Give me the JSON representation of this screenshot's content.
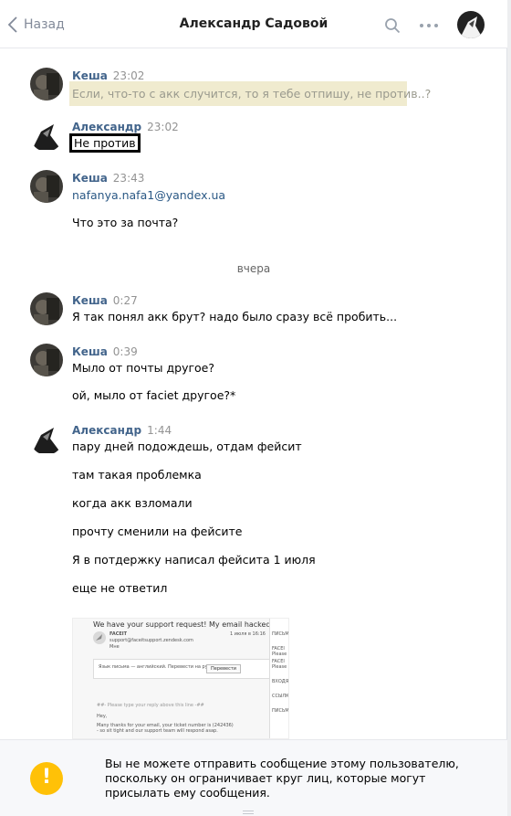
{
  "header": {
    "back_label": "Назад",
    "title": "Александр Садовой"
  },
  "messages": [
    {
      "author": "Кеша",
      "time": "23:02",
      "lines": [
        "Если, что-то с акк случится, то я тебе отпишу, не против..?"
      ]
    },
    {
      "author": "Александр",
      "time": "23:02",
      "lines": [
        "Не против"
      ]
    },
    {
      "author": "Кеша",
      "time": "23:43",
      "lines": [
        "nafanya.nafa1@yandex.ua",
        "Что это за почта?"
      ]
    },
    {
      "author": "Кеша",
      "time": "0:27",
      "lines": [
        "Я так понял акк брут? надо было сразу всё пробить..."
      ]
    },
    {
      "author": "Кеша",
      "time": "0:39",
      "lines": [
        "Мыло от почты другое?",
        "ой, мыло от faciet другое?*"
      ]
    },
    {
      "author": "Александр",
      "time": "1:44",
      "lines": [
        "пару дней подождешь, отдам фейсит",
        "там такая проблемка",
        "когда акк взломали",
        "прочту сменили на фейсите",
        "Я в потдержку написал фейсита 1 июля",
        "еще не ответил"
      ]
    }
  ],
  "date_separator": "вчера",
  "attachment": {
    "header": "We have your support request! My email hacked",
    "sender": "FACEIT",
    "sender_email": "support@faceitsupport.zendesk.com",
    "to": "Мне",
    "date": "1 июля в 16:16",
    "translate_text": "Язык письма — английский. Перевести на русский?",
    "translate_button": "Перевести",
    "reply_line": "##- Please type your reply above this line -##",
    "greeting": "Hey,",
    "body": "Many thanks for your email, your ticket number is (242436) - so sit tight and our support team will respond asap.",
    "side_items": [
      "ПИСЬМ",
      "FACEI",
      "Please",
      "FACEI",
      "Please",
      "ВХОДЯ",
      "ССЫЛК",
      "ПИСЬМ"
    ]
  },
  "footer": {
    "notice": "Вы не можете отправить сообщение этому пользователю, поскольку он ограничивает круг лиц, которые могут присылать ему сообщения."
  },
  "colors": {
    "author": "#42648b",
    "highlight_bg": "#f0ebcf",
    "warning": "#ffc107"
  }
}
